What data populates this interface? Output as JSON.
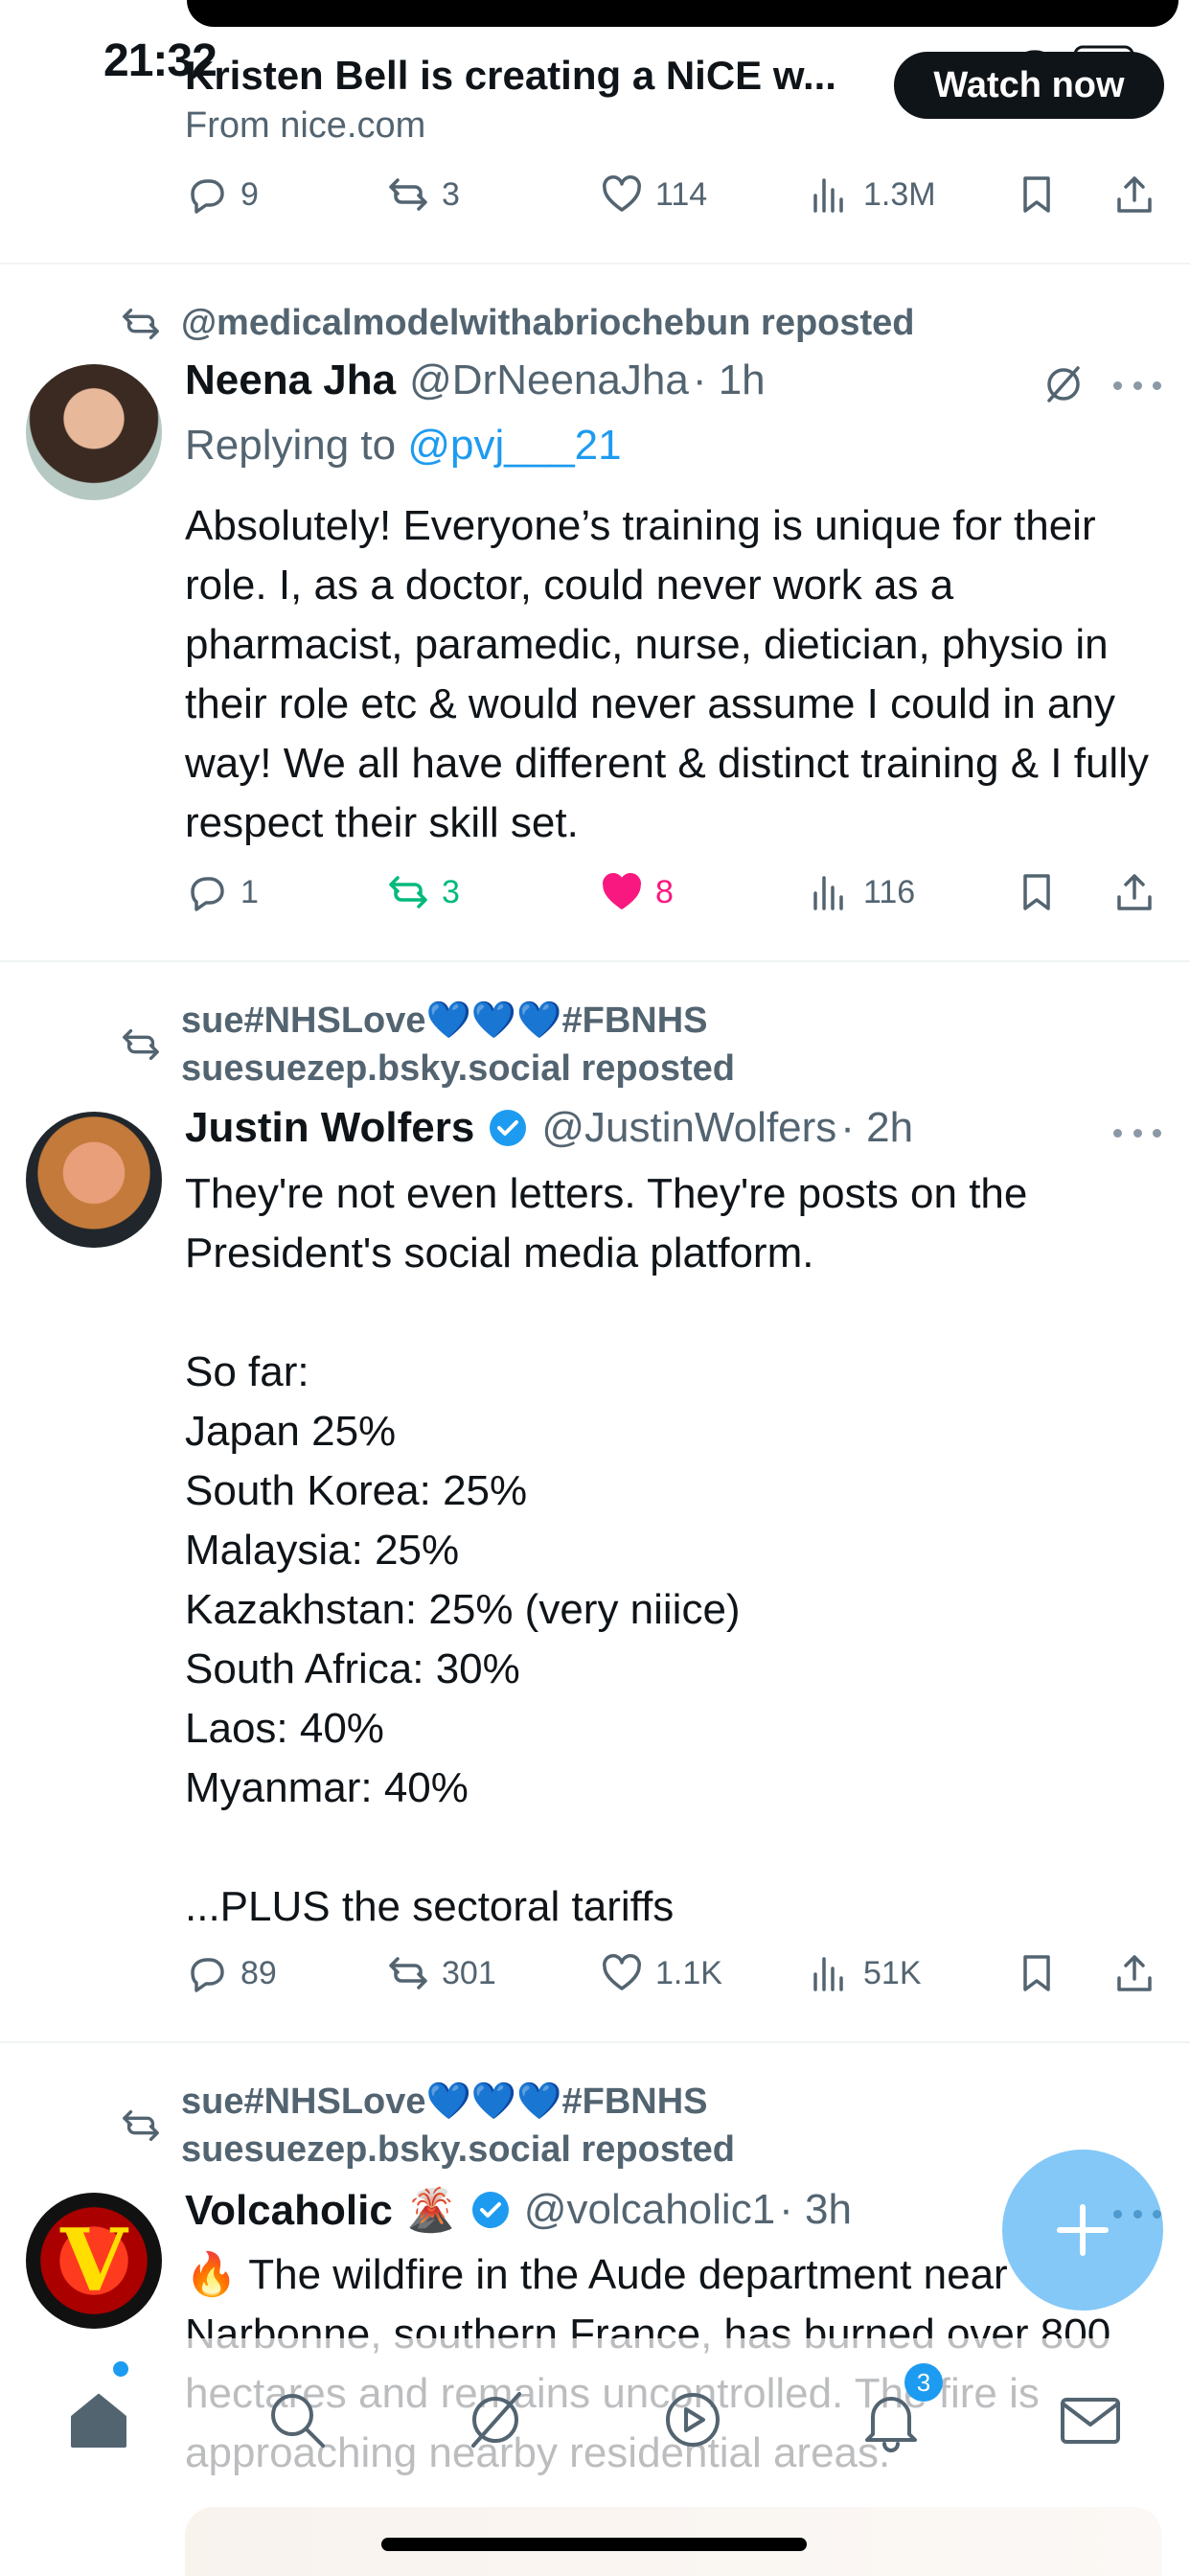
{
  "status": {
    "time": "21:32"
  },
  "promo": {
    "title": "Kristen Bell is creating a NiCE w...",
    "cta": "Watch now",
    "from": "From nice.com",
    "stats": {
      "replies": "9",
      "reposts": "3",
      "likes": "114",
      "views": "1.3M"
    }
  },
  "tweets": [
    {
      "repost_by": "@medicalmodelwithabriochebun reposted",
      "name": "Neena Jha",
      "handle": "@DrNeenaJha",
      "time": "· 1h",
      "reply_label": "Replying to ",
      "reply_target": "@pvj___21",
      "text": "Absolutely! Everyone’s training is unique for their role. I, as a doctor, could never work as a pharmacist, paramedic, nurse, dietician, physio in their role etc & would never assume I could in any way! We all have different & distinct training & I fully respect their skill set.",
      "stats": {
        "replies": "1",
        "reposts": "3",
        "likes": "8",
        "views": "116"
      }
    },
    {
      "repost_by_line1": "sue#NHSLove💙💙💙#FBNHS",
      "repost_by_line2": "suesuezep.bsky.social reposted",
      "name": "Justin Wolfers",
      "handle": "@JustinWolfers",
      "time": "· 2h",
      "text": "They're not even letters. They're posts on the President's social media platform.\n\nSo far:\nJapan 25%\nSouth Korea: 25%\nMalaysia: 25%\nKazakhstan: 25% (very niiice)\nSouth Africa: 30%\nLaos: 40%\nMyanmar: 40%\n\n...PLUS the sectoral tariffs",
      "stats": {
        "replies": "89",
        "reposts": "301",
        "likes": "1.1K",
        "views": "51K"
      }
    },
    {
      "repost_by_line1": "sue#NHSLove💙💙💙#FBNHS",
      "repost_by_line2": "suesuezep.bsky.social reposted",
      "name": "Volcaholic 🌋",
      "handle": "@volcaholic1",
      "time": "· 3h",
      "text": "🔥 The wildfire in the Aude department near Narbonne, southern France, has burned over 800 hectares and remains uncontrolled. The fire is approaching nearby residential areas."
    }
  ],
  "nav": {
    "items": [
      "home-icon",
      "search-icon",
      "grok-icon",
      "spaces-icon",
      "notifications-icon",
      "messages-icon"
    ],
    "notifications_badge": "3"
  },
  "colors": {
    "accent": "#1d9bf0",
    "repost_green": "#00ba7c",
    "like_pink": "#f91880",
    "muted": "#536471"
  }
}
